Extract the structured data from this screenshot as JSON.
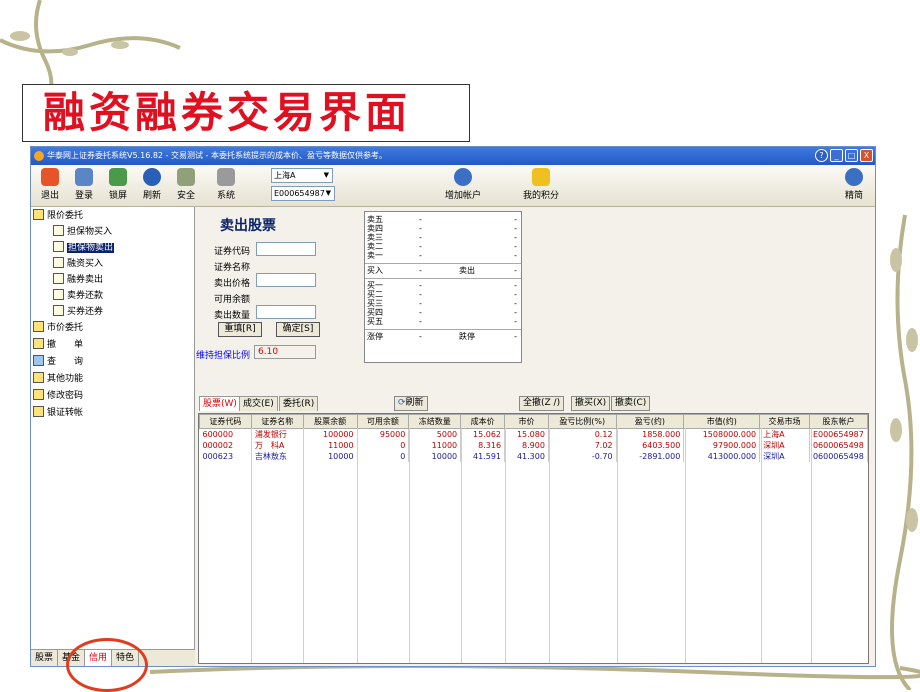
{
  "slide": {
    "title": "融资融券交易界面"
  },
  "window": {
    "title": "华泰网上证券委托系统V5.16.82 - 交易测试 - 本委托系统提示的成本价、盈亏等数据仅供参考。",
    "buttons": {
      "help": "?",
      "minimize": "_",
      "maximize": "□",
      "close": "X"
    }
  },
  "toolbar": {
    "exit": "退出",
    "login": "登录",
    "lock": "锁屏",
    "refresh": "刷新",
    "security": "安全",
    "system": "系统",
    "market_select": "上海A",
    "account_select": "E000654987",
    "add_account": "增加帐户",
    "my_points": "我的积分",
    "simple": "精简"
  },
  "sidebar": {
    "items": [
      {
        "label": "限价委托",
        "level": 0
      },
      {
        "label": "担保物买入",
        "level": 1
      },
      {
        "label": "担保物卖出",
        "level": 1,
        "selected": true
      },
      {
        "label": "融资买入",
        "level": 1
      },
      {
        "label": "融券卖出",
        "level": 1
      },
      {
        "label": "卖券还款",
        "level": 1
      },
      {
        "label": "买券还券",
        "level": 1
      },
      {
        "label": "市价委托",
        "level": 0
      },
      {
        "label": "撤　　单",
        "level": 0
      },
      {
        "label": "查　　询",
        "level": 0
      },
      {
        "label": "其他功能",
        "level": 0
      },
      {
        "label": "修改密码",
        "level": 0
      },
      {
        "label": "银证转帐",
        "level": 0
      }
    ],
    "bottom_tabs": [
      "股票",
      "基金",
      "信用",
      "特色"
    ]
  },
  "form": {
    "title": "卖出股票",
    "code_label": "证券代码",
    "name_label": "证券名称",
    "price_label": "卖出价格",
    "avail_label": "可用余额",
    "qty_label": "卖出数量",
    "reset_button": "重填[R]",
    "confirm_button": "确定[S]",
    "ratio_label": "维持担保比例",
    "ratio_value": "6.10"
  },
  "quote": {
    "sell": [
      {
        "name": "卖五",
        "a": "-",
        "c": "-"
      },
      {
        "name": "卖四",
        "a": "-",
        "c": "-"
      },
      {
        "name": "卖三",
        "a": "-",
        "c": "-"
      },
      {
        "name": "卖二",
        "a": "-",
        "c": "-"
      },
      {
        "name": "卖一",
        "a": "-",
        "c": "-"
      }
    ],
    "mid": {
      "left": "买入",
      "a": "-",
      "mid": "卖出",
      "c": "-"
    },
    "buy": [
      {
        "name": "买一",
        "a": "-",
        "c": "-"
      },
      {
        "name": "买二",
        "a": "-",
        "c": "-"
      },
      {
        "name": "买三",
        "a": "-",
        "c": "-"
      },
      {
        "name": "买四",
        "a": "-",
        "c": "-"
      },
      {
        "name": "买五",
        "a": "-",
        "c": "-"
      }
    ],
    "limit": {
      "up": "涨停",
      "a": "-",
      "down": "跌停",
      "c": "-"
    }
  },
  "tabs": {
    "stock": "股票(W)",
    "deal": "成交(E)",
    "order": "委托(R)",
    "refresh": "刷新",
    "cancel_all": "全撤(Z /)",
    "cancel_buy": "撤买(X)",
    "cancel_sell": "撤卖(C)"
  },
  "table": {
    "columns": [
      "证券代码",
      "证券名称",
      "股票余额",
      "可用余额",
      "冻结数量",
      "成本价",
      "市价",
      "盈亏比例(%)",
      "盈亏(约)",
      "市值(约)",
      "交易市场",
      "股东帐户"
    ],
    "rows": [
      [
        "600000",
        "浦发银行",
        "100000",
        "95000",
        "5000",
        "15.062",
        "15.080",
        "0.12",
        "1858.000",
        "1508000.000",
        "上海A",
        "E000654987"
      ],
      [
        "000002",
        "万　科A",
        "11000",
        "0",
        "11000",
        "8.316",
        "8.900",
        "7.02",
        "6403.500",
        "97900.000",
        "深圳A",
        "0600065498"
      ],
      [
        "000623",
        "吉林敖东",
        "10000",
        "0",
        "10000",
        "41.591",
        "41.300",
        "-0.70",
        "-2891.000",
        "413000.000",
        "深圳A",
        "0600065498"
      ]
    ],
    "row_colors": [
      "#c00000",
      "#c00000",
      "#1a1aa0"
    ]
  }
}
